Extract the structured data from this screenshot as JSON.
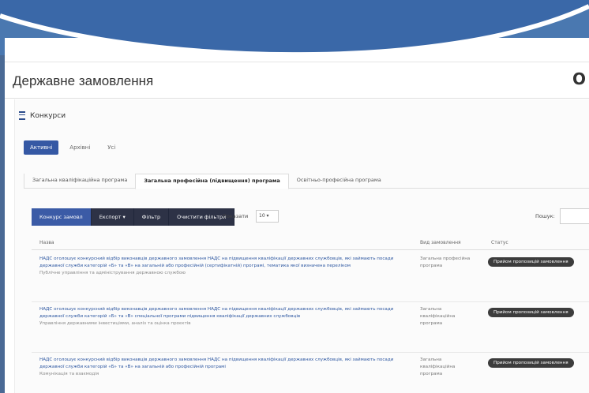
{
  "app": {
    "title": "Державне замовлення",
    "logo_text": "O"
  },
  "section": {
    "title": "Конкурси"
  },
  "tabs": [
    "Активні",
    "Архівні",
    "Усі"
  ],
  "subtabs": [
    "Загальна кваліфікаційна програма",
    "Загальна професійна (підвищення) програма",
    "Освітньо-професійна програма"
  ],
  "toolbar": {
    "buttons": [
      "Конкурс замовл",
      "Експорт ▾",
      "Фільтр",
      "Очистити фільтри"
    ],
    "show_label": "Показати",
    "show_value": "10 ▾",
    "search_label": "Пошук:"
  },
  "table": {
    "columns": [
      "Назва",
      "Вид замовлення",
      "Статус"
    ],
    "rows": [
      {
        "name": "НАДС оголошує конкурсний відбір виконавців державного замовлення НАДС на підвищення кваліфікації державних службовців, які займають посади державної служби категорій «Б» та «В» на загальній або професійній (сертифікатній) програмі, тематика якої визначена переліком",
        "sub": "Публічне управління та адміністрування державною службою",
        "kind": "Загальна професійна програма",
        "status": "Прийом пропозицій замовлення"
      },
      {
        "name": "НАДС оголошує конкурсний відбір виконавців державного замовлення НАДС на підвищення кваліфікації державних службовців, які займають посади державної служби категорій «Б» та «В» спеціальної програми підвищення кваліфікації державних службовців",
        "sub": "Управління державними інвестиціями, аналіз та оцінка проєктів",
        "kind": "Загальна кваліфікаційна програма",
        "status": "Прийом пропозицій замовлення"
      },
      {
        "name": "НАДС оголошує конкурсний відбір виконавців державного замовлення НАДС на підвищення кваліфікації державних службовців, які займають посади державної служби категорій «Б» та «В» на загальній або професійній програмі",
        "sub": "Комунікація та взаємодія",
        "kind": "Загальна кваліфікаційна програма",
        "status": "Прийом пропозицій замовлення"
      }
    ]
  }
}
